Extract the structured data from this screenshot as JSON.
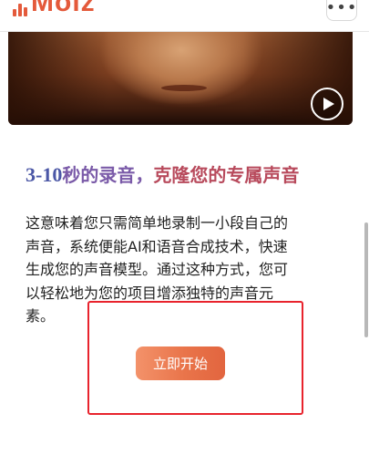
{
  "header": {
    "logo_text": "Moiz",
    "menu_icon": "more-horizontal-icon"
  },
  "video": {
    "play_icon": "play-icon"
  },
  "headline": {
    "number": "3-10",
    "part1": "秒的录音，",
    "part2": "克隆您的专属声音"
  },
  "description": {
    "lines": [
      "这意味着您只需简单地录制一小段自己的",
      "声音，系统便能AI和语音合成技术，快速",
      "生成您的声音模型。通过这种方式，您可",
      "以轻松地为您的项目增添独特的声音元",
      "素。"
    ]
  },
  "cta": {
    "label": "立即开始"
  },
  "colors": {
    "brand": "#e45a3b",
    "headline_number": "#4b57a6",
    "headline_purple": "#7a5aa8",
    "headline_red": "#b84a5c",
    "button": "#e9744a",
    "annotation": "#e8232d"
  }
}
